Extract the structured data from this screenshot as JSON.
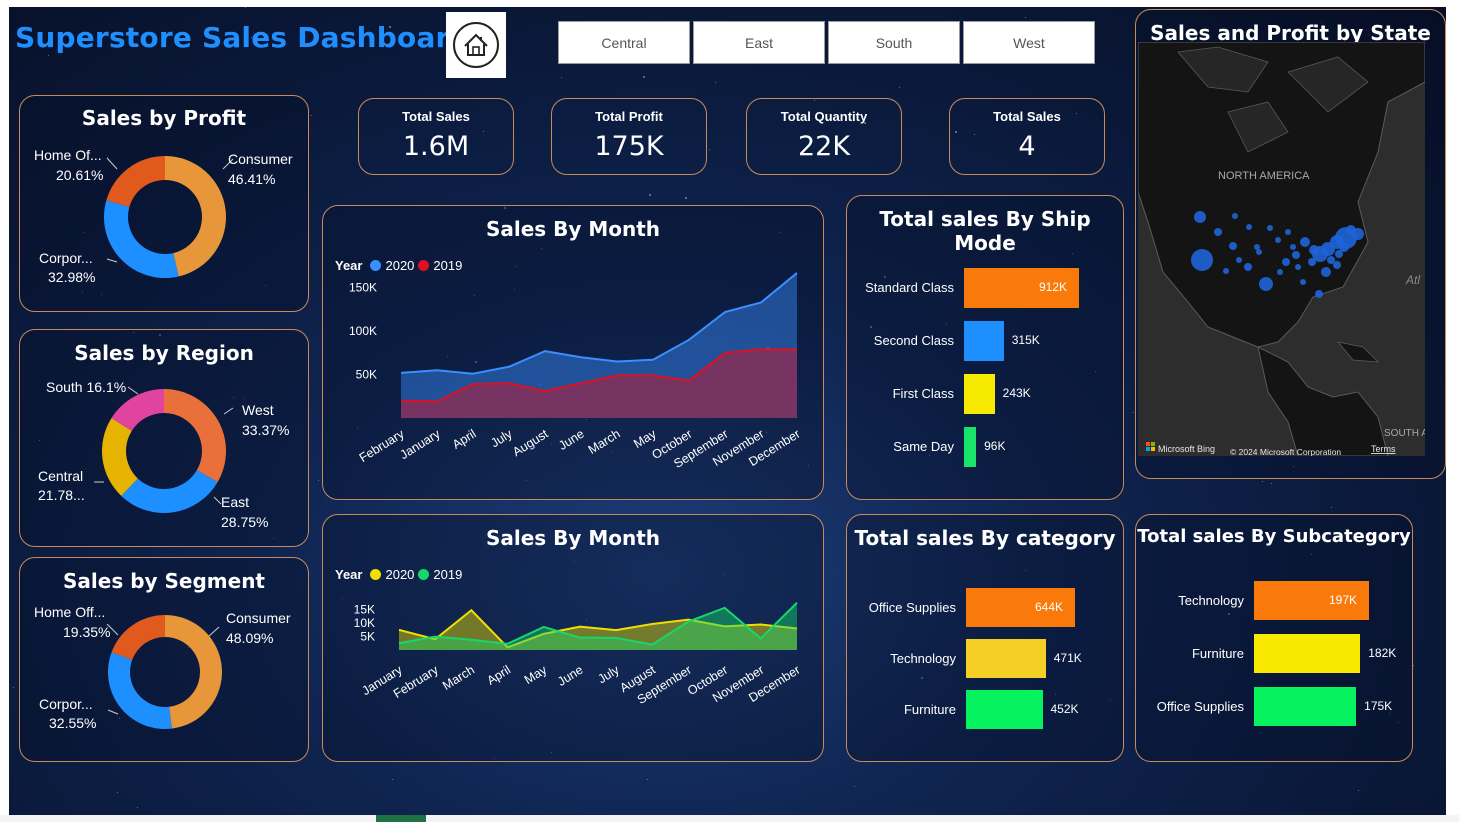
{
  "title": "Superstore Sales Dashboard",
  "home_icon": "home-icon",
  "regions": [
    "Central",
    "East",
    "South",
    "West"
  ],
  "kpis": [
    {
      "label": "Total Sales",
      "value": "1.6M"
    },
    {
      "label": "Total Profit",
      "value": "175K"
    },
    {
      "label": "Total Quantity",
      "value": "22K"
    },
    {
      "label": "Total Sales",
      "value": "4"
    }
  ],
  "donuts": {
    "profit": {
      "title": "Sales by Profit",
      "labels": [
        "Consumer",
        "Corpor...",
        "Home Of..."
      ],
      "pcts": [
        "46.41%",
        "32.98%",
        "20.61%"
      ],
      "colors": [
        "#e8963a",
        "#1e8fff",
        "#e05a1e"
      ]
    },
    "region": {
      "title": "Sales by Region",
      "labels": [
        "West",
        "East",
        "Central",
        "South 16.1%"
      ],
      "pcts": [
        "33.37%",
        "28.75%",
        "21.78...",
        ""
      ],
      "colors": [
        "#e9703a",
        "#1e8fff",
        "#e6b400",
        "#e0449e"
      ]
    },
    "segment": {
      "title": "Sales by Segment",
      "labels": [
        "Consumer",
        "Corpor...",
        "Home Off..."
      ],
      "pcts": [
        "48.09%",
        "32.55%",
        "19.35%"
      ],
      "colors": [
        "#e8963a",
        "#1e8fff",
        "#e05a1e"
      ]
    }
  },
  "sales_by_month_1": {
    "title": "Sales By Month",
    "legend_title": "Year",
    "y_ticks": [
      "150K",
      "100K",
      "50K"
    ],
    "chart_data": {
      "type": "area",
      "categories": [
        "February",
        "January",
        "April",
        "July",
        "August",
        "June",
        "March",
        "May",
        "October",
        "September",
        "November",
        "December"
      ],
      "series": [
        {
          "name": "2020",
          "color": "#3a8fff",
          "values": [
            52000,
            55000,
            51000,
            59000,
            77000,
            70000,
            65000,
            67000,
            90000,
            122000,
            133000,
            167000
          ]
        },
        {
          "name": "2019",
          "color": "#e01020",
          "values": [
            20000,
            19000,
            39000,
            40000,
            31000,
            40000,
            49000,
            49000,
            43000,
            75000,
            79000,
            79000
          ]
        }
      ],
      "ylim": [
        0,
        175000
      ],
      "xlabel": "",
      "ylabel": ""
    }
  },
  "sales_by_month_2": {
    "title": "Sales By Month",
    "legend_title": "Year",
    "y_ticks": [
      "15K",
      "10K",
      "5K"
    ],
    "chart_data": {
      "type": "area",
      "categories": [
        "January",
        "February",
        "March",
        "April",
        "May",
        "June",
        "July",
        "August",
        "September",
        "October",
        "November",
        "December"
      ],
      "series": [
        {
          "name": "2020",
          "color": "#f0e000",
          "values": [
            7500,
            4000,
            14800,
            1000,
            6000,
            8700,
            7400,
            9700,
            11300,
            8800,
            9500,
            8000
          ]
        },
        {
          "name": "2019",
          "color": "#16d86a",
          "values": [
            2500,
            5000,
            3800,
            2300,
            8600,
            4600,
            4500,
            2000,
            10600,
            15700,
            4300,
            17600
          ]
        }
      ],
      "ylim": [
        0,
        19000
      ],
      "xlabel": "",
      "ylabel": ""
    }
  },
  "ship_mode": {
    "title": "Total sales By Ship Mode",
    "chart_data": {
      "type": "bar",
      "categories": [
        "Standard Class",
        "Second Class",
        "First Class",
        "Same Day"
      ],
      "values": [
        912,
        315,
        243,
        96
      ],
      "value_labels": [
        "912K",
        "315K",
        "243K",
        "96K"
      ],
      "colors": [
        "#f97a0a",
        "#1e8fff",
        "#f5ea00",
        "#19e36a"
      ],
      "max": 912
    }
  },
  "category": {
    "title": "Total sales By category",
    "chart_data": {
      "type": "bar",
      "categories": [
        "Office Supplies",
        "Technology",
        "Furniture"
      ],
      "values": [
        644,
        471,
        452
      ],
      "value_labels": [
        "644K",
        "471K",
        "452K"
      ],
      "colors": [
        "#f97a0a",
        "#f4cf26",
        "#06f25e"
      ],
      "max": 644
    }
  },
  "subcategory": {
    "title": "Total sales By Subcategory",
    "chart_data": {
      "type": "bar",
      "categories": [
        "Technology",
        "Furniture",
        "Office Supplies"
      ],
      "values": [
        197,
        182,
        175
      ],
      "value_labels": [
        "197K",
        "182K",
        "175K"
      ],
      "colors": [
        "#f97a0a",
        "#f7ea00",
        "#06f25e"
      ],
      "max": 197
    }
  },
  "map": {
    "title": "Sales and Profit by State",
    "continent_label": "NORTH AMERICA",
    "south_label": "SOUTH A",
    "atl_label": "Atl",
    "bing": "Microsoft Bing",
    "copyright": "© 2024 Microsoft Corporation",
    "terms": "Terms",
    "bubble_color": "#1e64d8"
  }
}
